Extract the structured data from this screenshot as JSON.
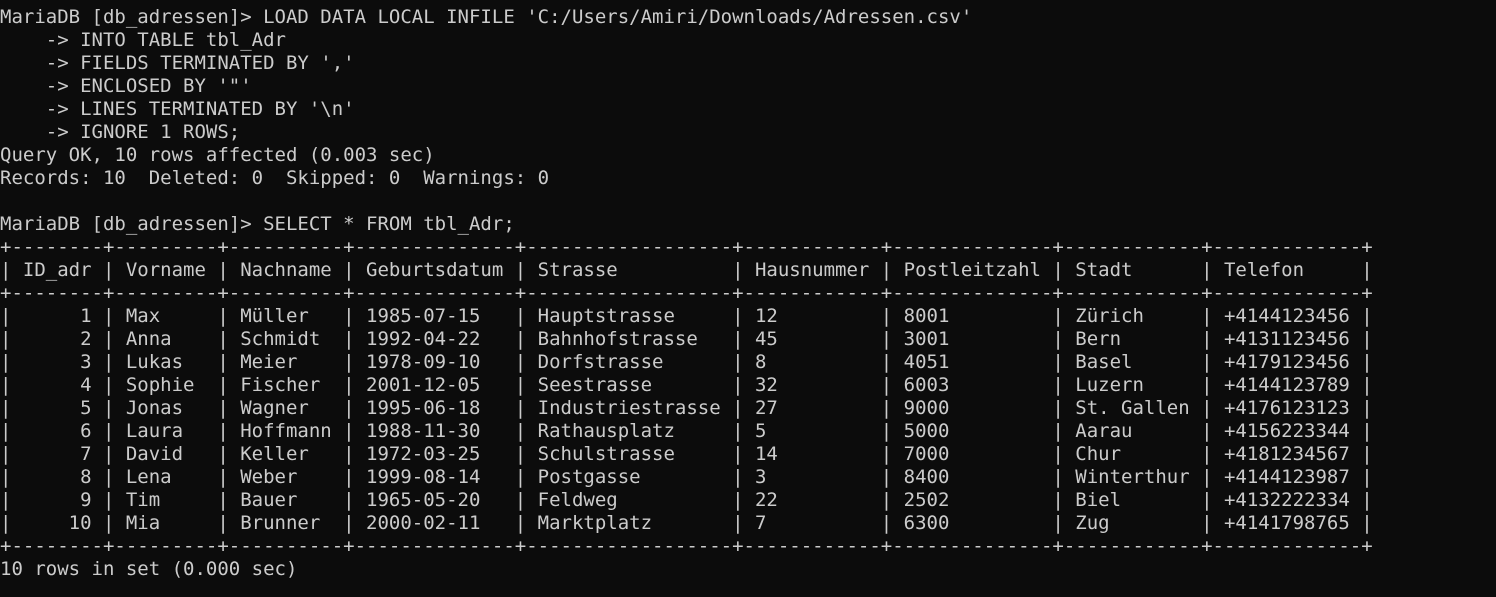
{
  "terminal": {
    "text_color": "#cccccc",
    "background": "#0c0c0c",
    "load_block": [
      "MariaDB [db_adressen]> LOAD DATA LOCAL INFILE 'C:/Users/Amiri/Downloads/Adressen.csv'",
      "    -> INTO TABLE tbl_Adr",
      "    -> FIELDS TERMINATED BY ','",
      "    -> ENCLOSED BY '\"'",
      "    -> LINES TERMINATED BY '\\n'",
      "    -> IGNORE 1 ROWS;",
      "Query OK, 10 rows affected (0.003 sec)",
      "Records: 10  Deleted: 0  Skipped: 0  Warnings: 0"
    ],
    "select_prompt": "MariaDB [db_adressen]> SELECT * FROM tbl_Adr;",
    "table": {
      "columns": [
        "ID_adr",
        "Vorname",
        "Nachname",
        "Geburtsdatum",
        "Strasse",
        "Hausnummer",
        "Postleitzahl",
        "Stadt",
        "Telefon"
      ],
      "align_right": [
        true,
        false,
        false,
        false,
        false,
        false,
        false,
        false,
        false
      ],
      "rows": [
        [
          "1",
          "Max",
          "Müller",
          "1985-07-15",
          "Hauptstrasse",
          "12",
          "8001",
          "Zürich",
          "+4144123456"
        ],
        [
          "2",
          "Anna",
          "Schmidt",
          "1992-04-22",
          "Bahnhofstrasse",
          "45",
          "3001",
          "Bern",
          "+4131123456"
        ],
        [
          "3",
          "Lukas",
          "Meier",
          "1978-09-10",
          "Dorfstrasse",
          "8",
          "4051",
          "Basel",
          "+4179123456"
        ],
        [
          "4",
          "Sophie",
          "Fischer",
          "2001-12-05",
          "Seestrasse",
          "32",
          "6003",
          "Luzern",
          "+4144123789"
        ],
        [
          "5",
          "Jonas",
          "Wagner",
          "1995-06-18",
          "Industriestrasse",
          "27",
          "9000",
          "St. Gallen",
          "+4176123123"
        ],
        [
          "6",
          "Laura",
          "Hoffmann",
          "1988-11-30",
          "Rathausplatz",
          "5",
          "5000",
          "Aarau",
          "+4156223344"
        ],
        [
          "7",
          "David",
          "Keller",
          "1972-03-25",
          "Schulstrasse",
          "14",
          "7000",
          "Chur",
          "+4181234567"
        ],
        [
          "8",
          "Lena",
          "Weber",
          "1999-08-14",
          "Postgasse",
          "3",
          "8400",
          "Winterthur",
          "+4144123987"
        ],
        [
          "9",
          "Tim",
          "Bauer",
          "1965-05-20",
          "Feldweg",
          "22",
          "2502",
          "Biel",
          "+4132222334"
        ],
        [
          "10",
          "Mia",
          "Brunner",
          "2000-02-11",
          "Marktplatz",
          "7",
          "6300",
          "Zug",
          "+4141798765"
        ]
      ]
    },
    "result_summary": "10 rows in set (0.000 sec)"
  }
}
